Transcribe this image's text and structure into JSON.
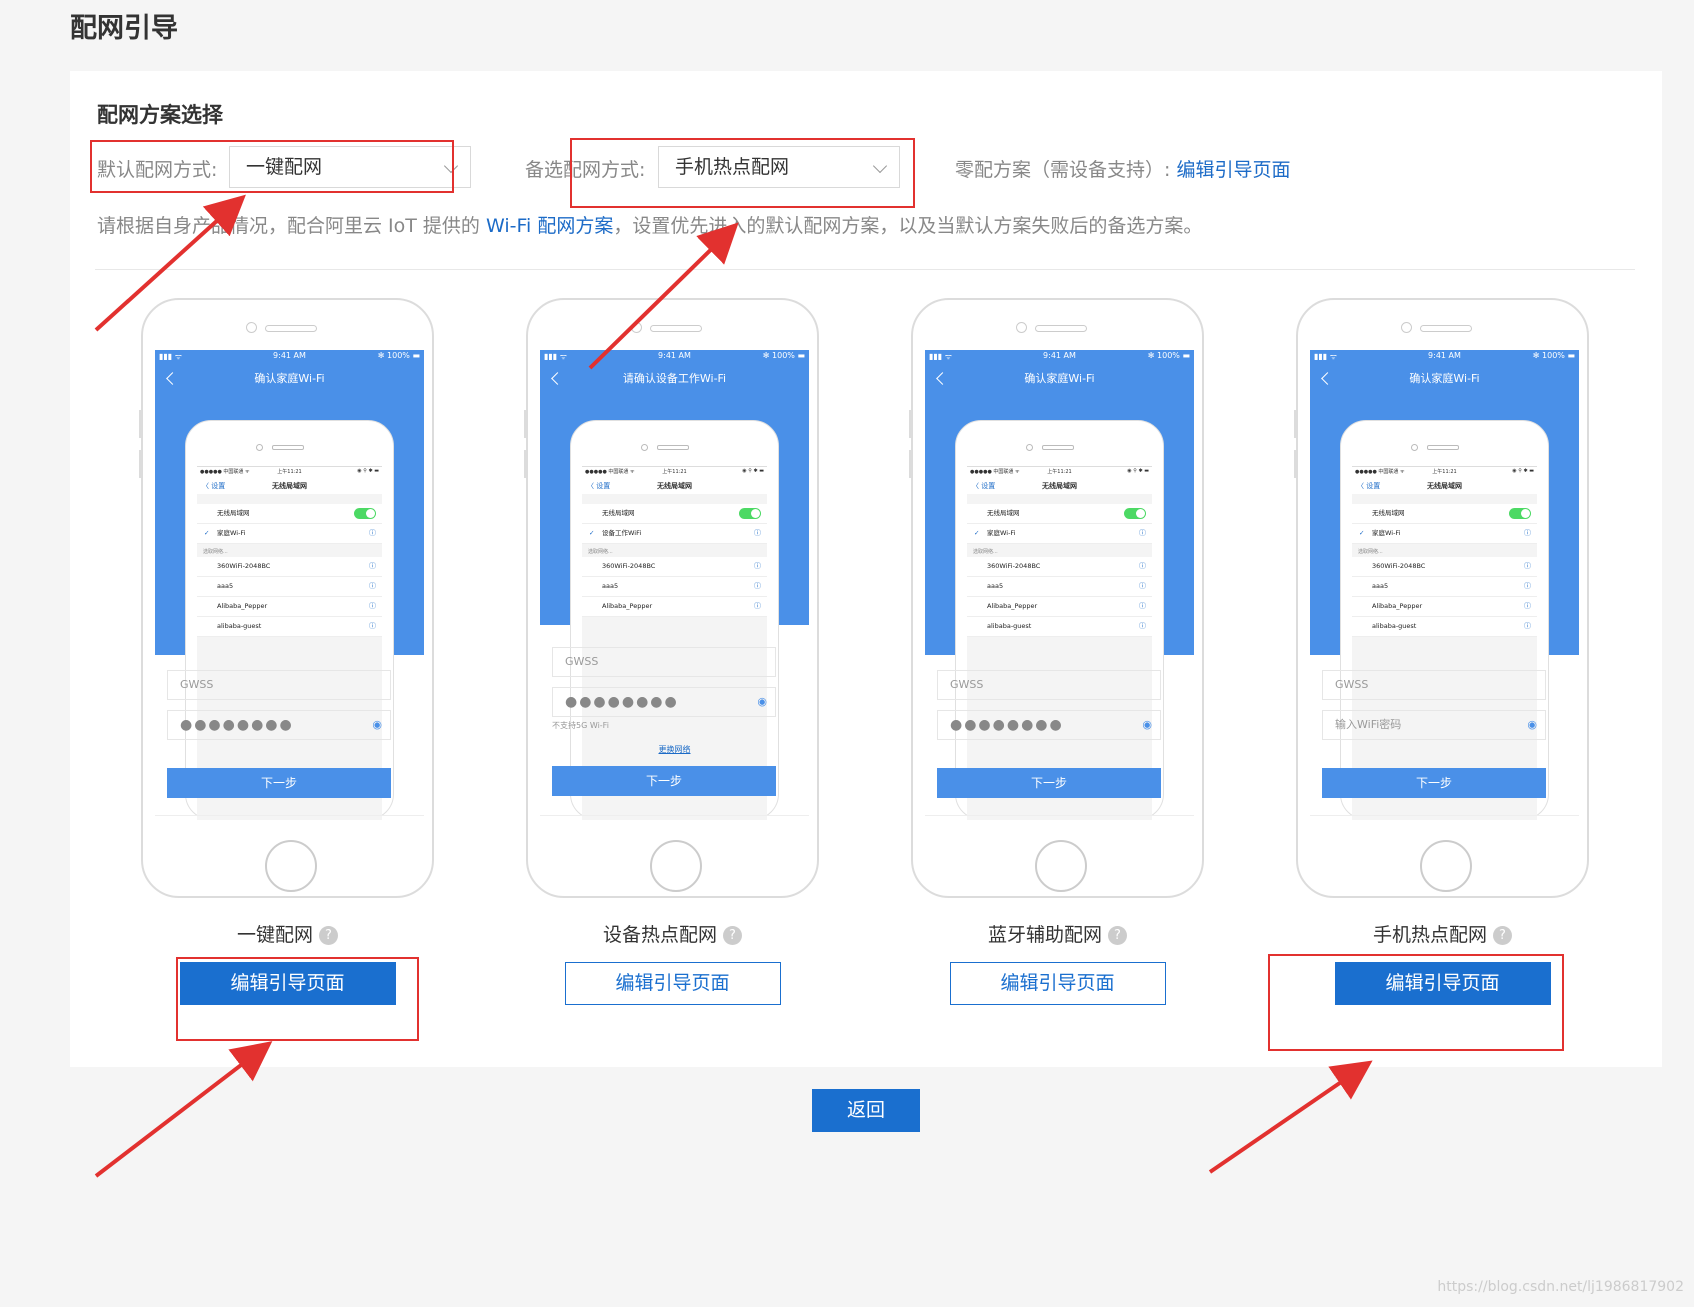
{
  "page": {
    "title": "配网引导"
  },
  "section": {
    "title": "配网方案选择",
    "default_label": "默认配网方式:",
    "default_value": "一键配网",
    "backup_label": "备选配网方式:",
    "backup_value": "手机热点配网",
    "zero_label": "零配方案（需设备支持）:",
    "zero_link": "编辑引导页面",
    "desc_pre": "请根据自身产品情况，配合阿里云 IoT 提供的 ",
    "desc_link": "Wi-Fi 配网方案",
    "desc_post": "，设置优先进入的默认配网方案，以及当默认方案失败后的备选方案。"
  },
  "phone_common": {
    "time": "9:41 AM",
    "battery": "✻ 100% ▬",
    "signal": "▮▮▮ ᯤ",
    "inner_carrier": "●●●●● 中国联通 ᯤ",
    "inner_time": "上午11:21",
    "inner_right": "◉ ⚲ ✱ ▬",
    "inner_back": "〈 设置",
    "inner_title": "无线局域网",
    "wlan_label": "无线局域网",
    "other_header": "选取网络...",
    "networks": [
      "360WiFi-2048BC",
      "aaa5",
      "Alibaba_Pepper",
      "alibaba-guest"
    ],
    "ssid_placeholder": "GWSS",
    "password_dots": "●●●●●●●●",
    "eye": "◉",
    "next": "下一步",
    "info": "ⓘ",
    "wifi": "ᯤ",
    "lock": "🔒"
  },
  "cards": [
    {
      "screen_title": "确认家庭Wi-Fi",
      "connected": "家庭Wi-Fi",
      "caption": "一键配网",
      "button": "编辑引导页面"
    },
    {
      "screen_title": "请确认设备工作Wi-Fi",
      "connected": "设备工作WiFi",
      "caption": "设备热点配网",
      "button": "编辑引导页面",
      "hint": "不支持5G Wi-Fi",
      "switch": "更换网络"
    },
    {
      "screen_title": "确认家庭Wi-Fi",
      "connected": "家庭Wi-Fi",
      "caption": "蓝牙辅助配网",
      "button": "编辑引导页面"
    },
    {
      "screen_title": "确认家庭Wi-Fi",
      "connected": "家庭Wi-Fi",
      "caption": "手机热点配网",
      "button": "编辑引导页面",
      "password_placeholder": "输入WiFi密码"
    }
  ],
  "help_icon": "?",
  "return_button": "返回",
  "watermark": "https://blog.csdn.net/lj1986817902",
  "colors": {
    "accent": "#1a6fcf",
    "phone_blue": "#4a90e8",
    "annotation_red": "#e2312f"
  }
}
